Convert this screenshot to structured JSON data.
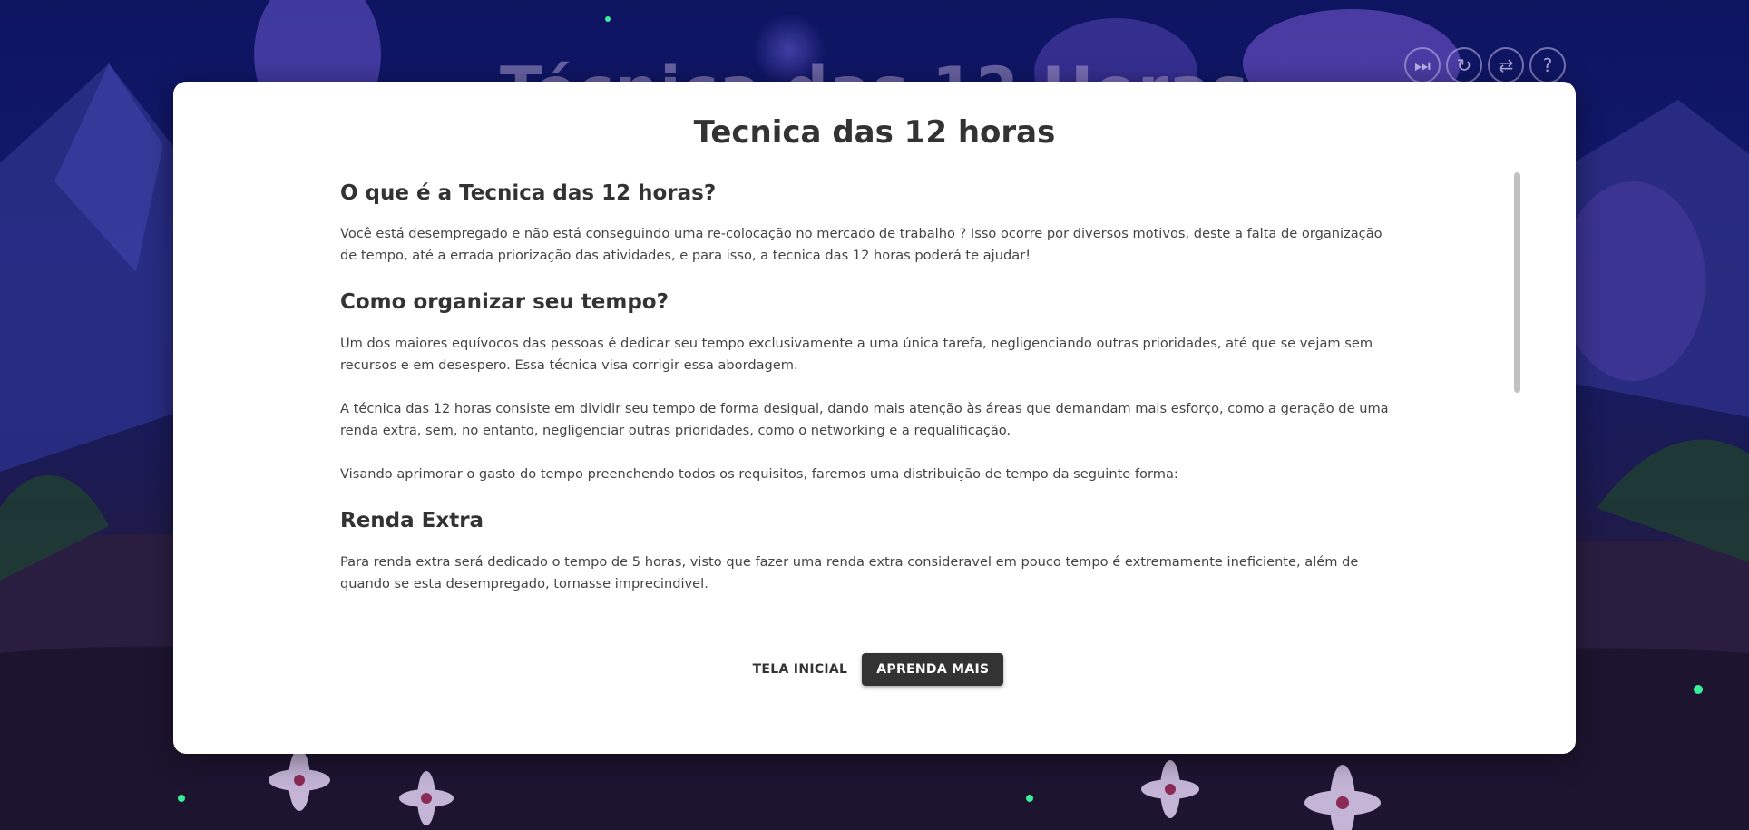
{
  "background": {
    "title": "Técnica das 12 Horas"
  },
  "toolbar": {
    "icons": [
      {
        "name": "skip-icon",
        "glyph": "⏭"
      },
      {
        "name": "refresh-icon",
        "glyph": "↻"
      },
      {
        "name": "swap-icon",
        "glyph": "⇄"
      },
      {
        "name": "help-icon",
        "glyph": "?"
      }
    ]
  },
  "modal": {
    "title": "Tecnica das 12 horas",
    "sections": [
      {
        "heading": "O que é a Tecnica das 12 horas?",
        "paragraphs": [
          " Você está desempregado e não está conseguindo uma re-colocação no mercado de trabalho ? Isso ocorre por diversos motivos, deste a falta de organização de tempo, até a errada priorização das atividades, e para isso, a tecnica das 12 horas poderá te ajudar!"
        ]
      },
      {
        "heading": "Como organizar seu tempo?",
        "paragraphs": [
          "Um dos maiores equívocos das pessoas é dedicar seu tempo exclusivamente a uma única tarefa, negligenciando outras prioridades, até que se vejam sem recursos e em desespero. Essa técnica visa corrigir essa abordagem.",
          "A técnica das 12 horas consiste em dividir seu tempo de forma desigual, dando mais atenção às áreas que demandam mais esforço, como a geração de uma renda extra, sem, no entanto, negligenciar outras prioridades, como o networking e a requalificação.",
          "Visando aprimorar o gasto do tempo preenchendo todos os requisitos, faremos uma distribuição de tempo da seguinte forma:"
        ]
      },
      {
        "heading": "Renda Extra",
        "paragraphs": [
          "Para renda extra será dedicado o tempo de 5 horas, visto que fazer uma renda extra consideravel em pouco tempo é extremamente ineficiente, além de quando se esta desempregado, tornasse imprecindivel."
        ]
      }
    ],
    "buttons": {
      "home": "TELA INICIAL",
      "learn_more": "APRENDA MAIS"
    }
  },
  "colors": {
    "modal_bg": "#ffffff",
    "primary_button": "#333333",
    "text": "#444444"
  }
}
